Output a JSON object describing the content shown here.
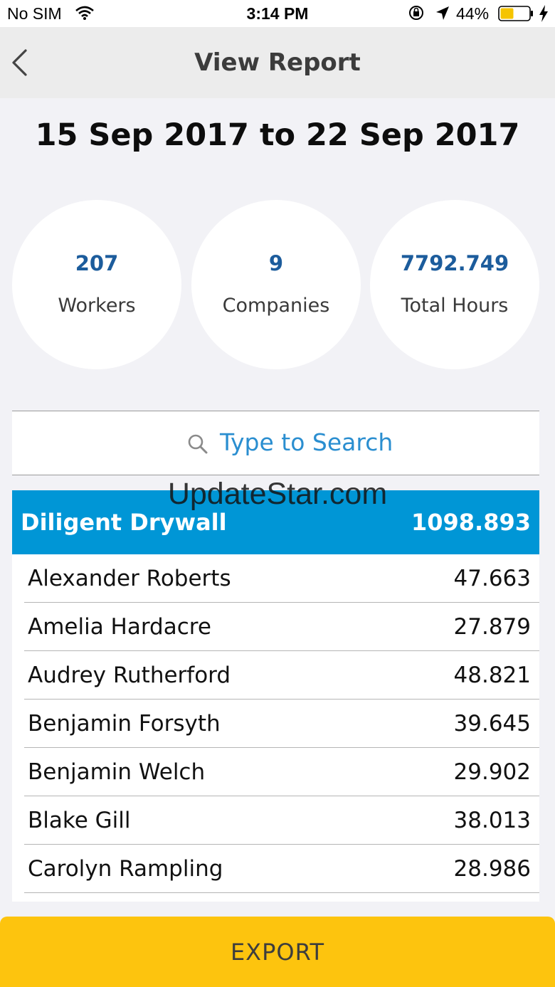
{
  "status_bar": {
    "carrier": "No SIM",
    "time": "3:14 PM",
    "battery_percent": "44%",
    "battery_color": "#f5c400"
  },
  "nav": {
    "title": "View Report",
    "back_icon": "chevron-left-icon"
  },
  "report": {
    "date_range": "15 Sep 2017 to 22 Sep 2017",
    "stats": [
      {
        "value": "207",
        "label": "Workers"
      },
      {
        "value": "9",
        "label": "Companies"
      },
      {
        "value": "7792.749",
        "label": "Total Hours"
      }
    ]
  },
  "search": {
    "placeholder": "Type to Search",
    "icon": "search-icon"
  },
  "group": {
    "name": "Diligent Drywall",
    "value": "1098.893",
    "color": "#0096d6"
  },
  "rows": [
    {
      "name": "Alexander Roberts",
      "value": "47.663"
    },
    {
      "name": "Amelia Hardacre",
      "value": "27.879"
    },
    {
      "name": "Audrey Rutherford",
      "value": "48.821"
    },
    {
      "name": "Benjamin Forsyth",
      "value": "39.645"
    },
    {
      "name": "Benjamin Welch",
      "value": "29.902"
    },
    {
      "name": "Blake Gill",
      "value": "38.013"
    },
    {
      "name": "Carolyn Rampling",
      "value": "28.986"
    }
  ],
  "watermark": "UpdateStar.com",
  "export_label": "EXPORT",
  "export_color": "#fdc40e"
}
